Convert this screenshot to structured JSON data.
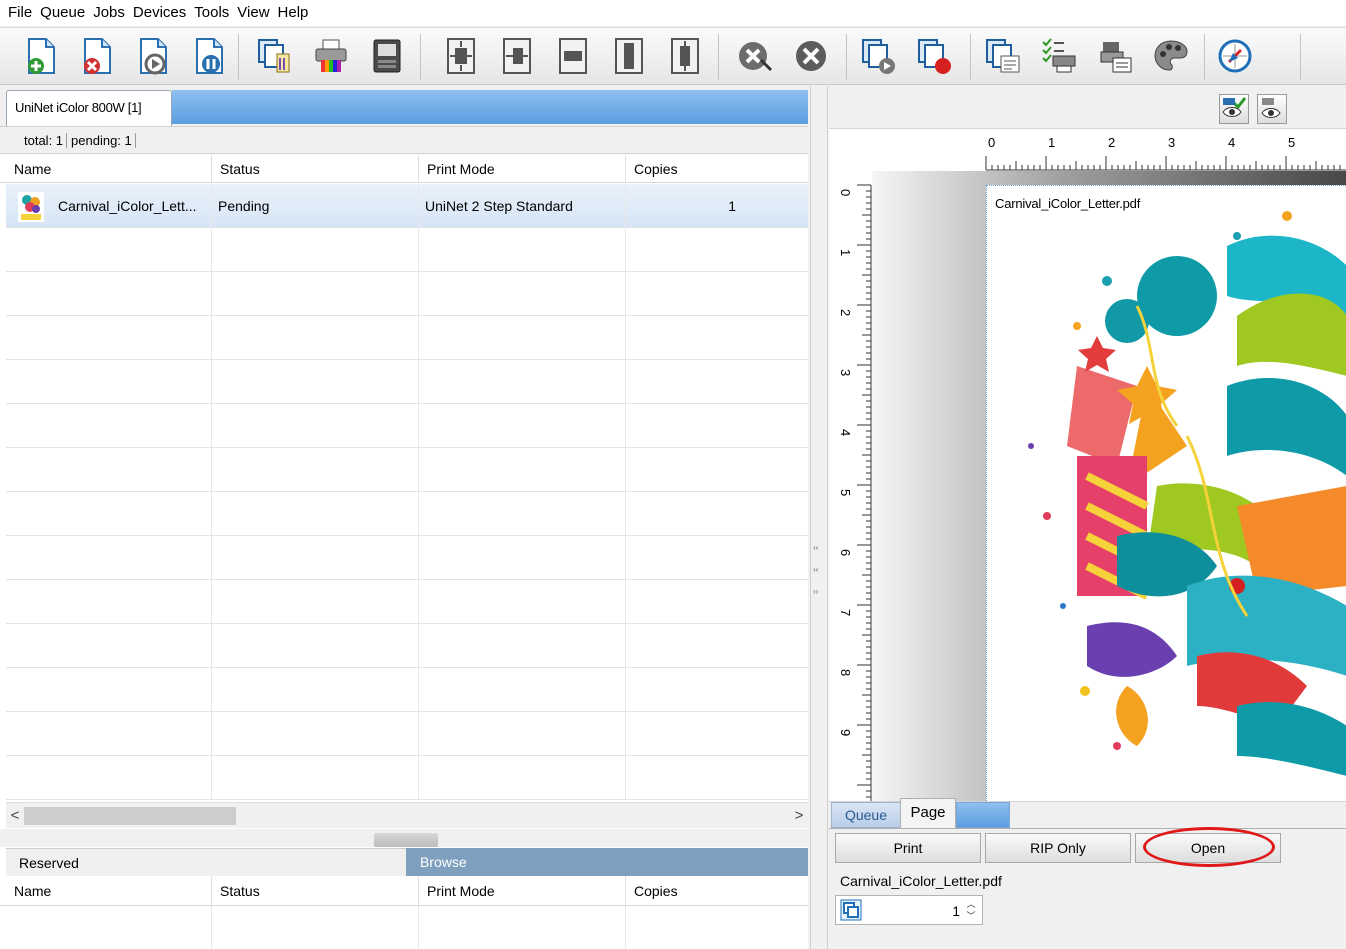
{
  "menu": [
    "File",
    "Queue",
    "Jobs",
    "Devices",
    "Tools",
    "View",
    "Help"
  ],
  "toolbar": {
    "buttons": [
      "add-job-icon",
      "delete-job-icon",
      "start-job-icon",
      "pause-job-icon",
      "copy-job-icon",
      "printer-icon",
      "rip-server-icon",
      "fit-page-icon",
      "center-horizontal-icon",
      "fit-width-icon",
      "fit-height-icon",
      "center-vertical-icon",
      "cancel-job-icon",
      "stop-job-icon",
      "resume-queue-icon",
      "stop-queue-icon",
      "queue-properties-icon",
      "printer-setup-icon",
      "device-settings-icon",
      "color-palette-icon",
      "calibration-icon"
    ]
  },
  "printer_tab": {
    "label": "UniNet iColor 800W [1]"
  },
  "counts": {
    "total": "total: 1",
    "pending": "pending: 1"
  },
  "job_grid": {
    "columns": [
      "Name",
      "Status",
      "Print Mode",
      "Copies"
    ],
    "rows": [
      {
        "name": "Carnival_iColor_Lett...",
        "status": "Pending",
        "print_mode": "UniNet 2 Step Standard",
        "copies": "1"
      }
    ]
  },
  "scroll": {
    "left_arrow": "<",
    "right_arrow": ">"
  },
  "bottom_tabs": {
    "reserved": "Reserved",
    "browse": "Browse"
  },
  "reserved_grid": {
    "columns": [
      "Name",
      "Status",
      "Print Mode",
      "Copies"
    ]
  },
  "preview": {
    "ruler_top": [
      "0",
      "1",
      "2",
      "3",
      "4",
      "5"
    ],
    "ruler_left": [
      "0",
      "1",
      "2",
      "3",
      "4",
      "5",
      "6",
      "7",
      "8",
      "9"
    ],
    "page_caption": "Carnival_iColor_Letter.pdf"
  },
  "panel": {
    "tabs": {
      "queue": "Queue",
      "page": "Page"
    },
    "print_label": "Print",
    "rip_only_label": "RIP Only",
    "open_label": "Open",
    "filename": "Carnival_iColor_Letter.pdf",
    "copies": "1"
  },
  "colors": {
    "accent_blue": "#5a9de0",
    "browse_tab": "#7f9fbf",
    "highlight_red": "#e01818"
  }
}
